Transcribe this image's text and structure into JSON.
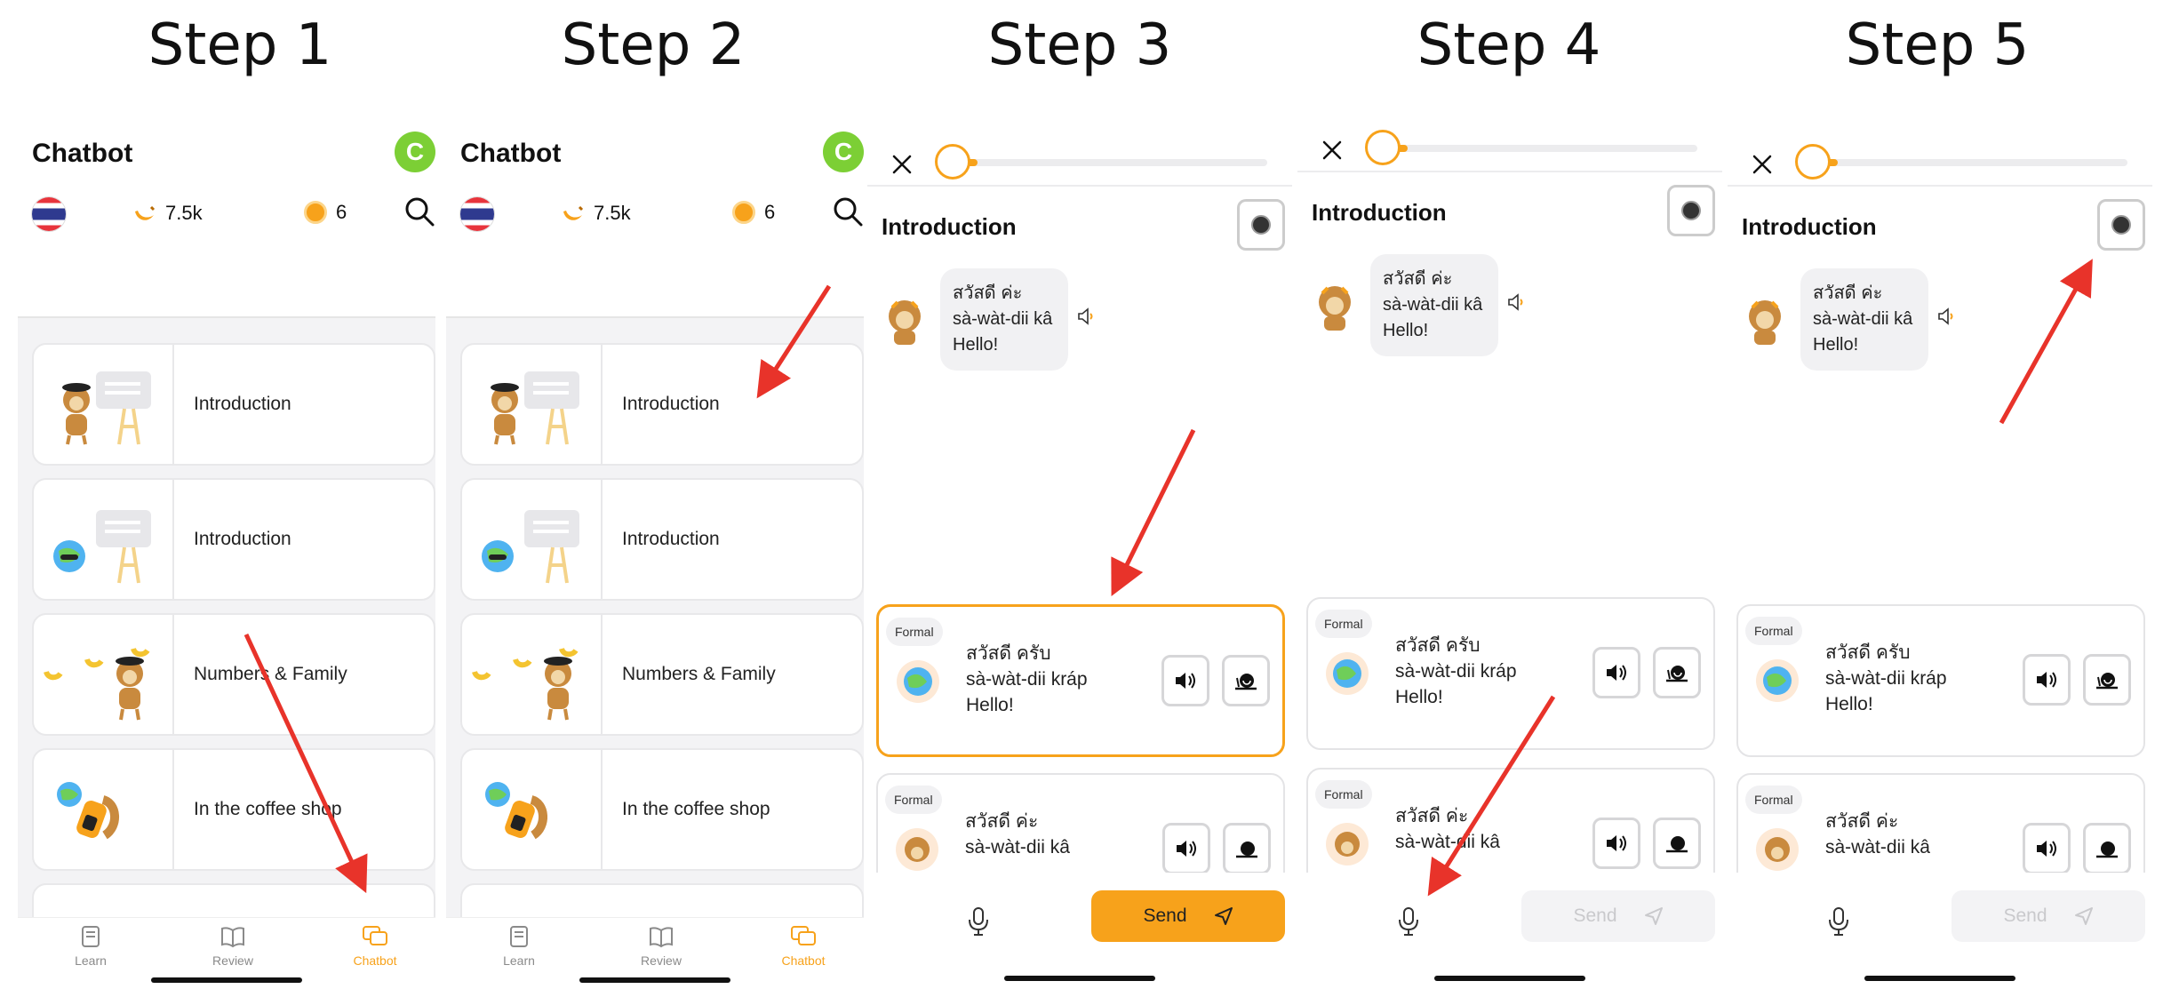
{
  "steps": [
    "Step 1",
    "Step 2",
    "Step 3",
    "Step 4",
    "Step 5"
  ],
  "list_screen": {
    "title": "Chatbot",
    "avatar_letter": "C",
    "bananas": "7.5k",
    "coins": "6",
    "cards": [
      "Introduction",
      "Introduction",
      "Numbers & Family",
      "In the coffee shop"
    ],
    "tabs": [
      "Learn",
      "Review",
      "Chatbot"
    ]
  },
  "chat_screen": {
    "title": "Introduction",
    "bot_thai": "สวัสดี ค่ะ",
    "bot_roman": "sà-wàt-dii kâ",
    "bot_english": "Hello!",
    "option1": {
      "tag": "Formal",
      "thai": "สวัสดี ครับ",
      "roman": "sà-wàt-dii kráp",
      "english": "Hello!"
    },
    "option2": {
      "tag": "Formal",
      "thai": "สวัสดี ค่ะ",
      "roman": "sà-wàt-dii kâ"
    },
    "send_label": "Send"
  },
  "colors": {
    "accent": "#f7a21b",
    "arrow": "#e8332a",
    "avatar": "#7ccf35"
  },
  "icons": [
    "banana-icon",
    "coin-icon",
    "search-icon",
    "close-icon",
    "mic-icon",
    "send-icon",
    "speaker-icon",
    "snail-icon",
    "settings-icon"
  ]
}
